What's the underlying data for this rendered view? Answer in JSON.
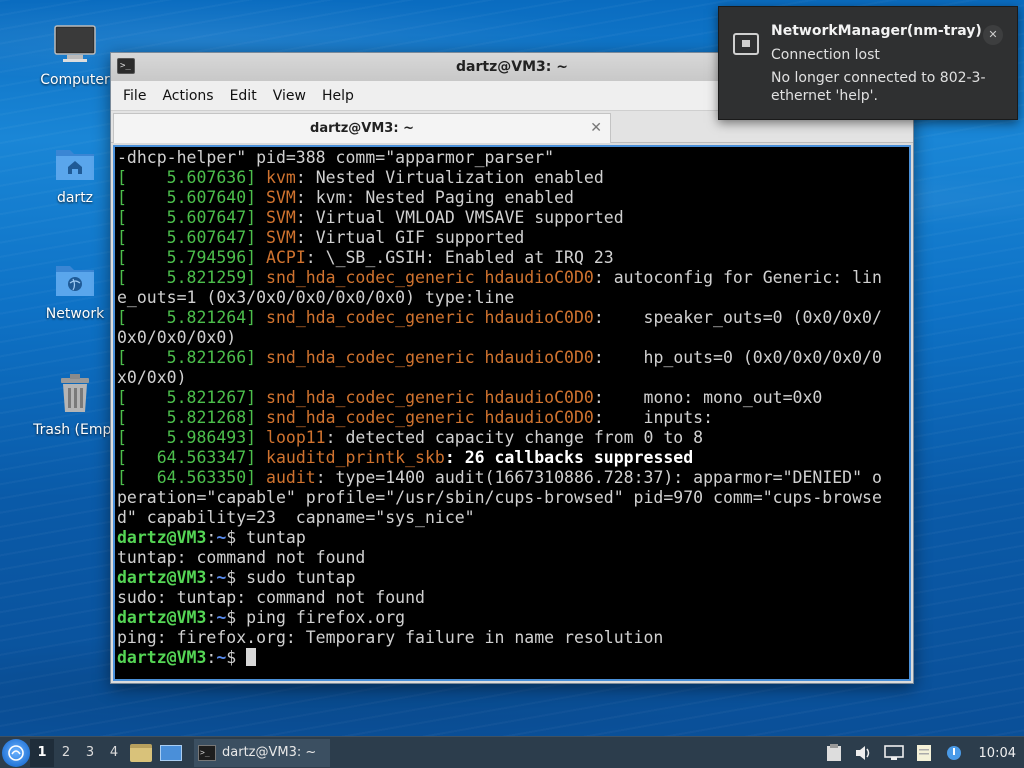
{
  "desktop": {
    "icons": [
      {
        "label": "Computer"
      },
      {
        "label": "dartz"
      },
      {
        "label": "Network"
      },
      {
        "label": "Trash (Empt"
      }
    ]
  },
  "window": {
    "title": "dartz@VM3: ~",
    "menu": [
      "File",
      "Actions",
      "Edit",
      "View",
      "Help"
    ],
    "tab_label": "dartz@VM3: ~",
    "tab_close": "✕"
  },
  "terminal": {
    "lines": [
      [
        {
          "t": "-dhcp-helper\" pid=388 comm=\"apparmor_parser\""
        }
      ],
      [
        {
          "t": "[    5.607636]",
          "c": "ts"
        },
        {
          "t": " "
        },
        {
          "t": "kvm",
          "c": "sub"
        },
        {
          "t": ": Nested Virtualization enabled"
        }
      ],
      [
        {
          "t": "[    5.607640]",
          "c": "ts"
        },
        {
          "t": " "
        },
        {
          "t": "SVM",
          "c": "sub"
        },
        {
          "t": ": kvm: Nested Paging enabled"
        }
      ],
      [
        {
          "t": "[    5.607647]",
          "c": "ts"
        },
        {
          "t": " "
        },
        {
          "t": "SVM",
          "c": "sub"
        },
        {
          "t": ": Virtual VMLOAD VMSAVE supported"
        }
      ],
      [
        {
          "t": "[    5.607647]",
          "c": "ts"
        },
        {
          "t": " "
        },
        {
          "t": "SVM",
          "c": "sub"
        },
        {
          "t": ": Virtual GIF supported"
        }
      ],
      [
        {
          "t": "[    5.794596]",
          "c": "ts"
        },
        {
          "t": " "
        },
        {
          "t": "ACPI",
          "c": "sub"
        },
        {
          "t": ": \\_SB_.GSIH: Enabled at IRQ 23"
        }
      ],
      [
        {
          "t": "[    5.821259]",
          "c": "ts"
        },
        {
          "t": " "
        },
        {
          "t": "snd_hda_codec_generic hdaudioC0D0",
          "c": "sub"
        },
        {
          "t": ": autoconfig for Generic: lin"
        }
      ],
      [
        {
          "t": "e_outs=1 (0x3/0x0/0x0/0x0/0x0) type:line"
        }
      ],
      [
        {
          "t": "[    5.821264]",
          "c": "ts"
        },
        {
          "t": " "
        },
        {
          "t": "snd_hda_codec_generic hdaudioC0D0",
          "c": "sub"
        },
        {
          "t": ":    speaker_outs=0 (0x0/0x0/"
        }
      ],
      [
        {
          "t": "0x0/0x0/0x0)"
        }
      ],
      [
        {
          "t": "[    5.821266]",
          "c": "ts"
        },
        {
          "t": " "
        },
        {
          "t": "snd_hda_codec_generic hdaudioC0D0",
          "c": "sub"
        },
        {
          "t": ":    hp_outs=0 (0x0/0x0/0x0/0"
        }
      ],
      [
        {
          "t": "x0/0x0)"
        }
      ],
      [
        {
          "t": "[    5.821267]",
          "c": "ts"
        },
        {
          "t": " "
        },
        {
          "t": "snd_hda_codec_generic hdaudioC0D0",
          "c": "sub"
        },
        {
          "t": ":    mono: mono_out=0x0"
        }
      ],
      [
        {
          "t": "[    5.821268]",
          "c": "ts"
        },
        {
          "t": " "
        },
        {
          "t": "snd_hda_codec_generic hdaudioC0D0",
          "c": "sub"
        },
        {
          "t": ":    inputs:"
        }
      ],
      [
        {
          "t": "[    5.986493]",
          "c": "ts"
        },
        {
          "t": " "
        },
        {
          "t": "loop11",
          "c": "sub"
        },
        {
          "t": ": detected capacity change from 0 to 8"
        }
      ],
      [
        {
          "t": "[   64.563347]",
          "c": "ts"
        },
        {
          "t": " "
        },
        {
          "t": "kauditd_printk_skb",
          "c": "sub"
        },
        {
          "t": ": 26 callbacks suppressed",
          "c": "boldw"
        }
      ],
      [
        {
          "t": "[   64.563350]",
          "c": "ts"
        },
        {
          "t": " "
        },
        {
          "t": "audit",
          "c": "sub"
        },
        {
          "t": ": type=1400 audit(1667310886.728:37): apparmor=\"DENIED\" o"
        }
      ],
      [
        {
          "t": "peration=\"capable\" profile=\"/usr/sbin/cups-browsed\" pid=970 comm=\"cups-browse"
        }
      ],
      [
        {
          "t": "d\" capability=23  capname=\"sys_nice\""
        }
      ],
      [
        {
          "t": "dartz@VM3",
          "c": "prompt-user"
        },
        {
          "t": ":"
        },
        {
          "t": "~",
          "c": "prompt-path"
        },
        {
          "t": "$ tuntap"
        }
      ],
      [
        {
          "t": "tuntap: command not found"
        }
      ],
      [
        {
          "t": "dartz@VM3",
          "c": "prompt-user"
        },
        {
          "t": ":"
        },
        {
          "t": "~",
          "c": "prompt-path"
        },
        {
          "t": "$ sudo tuntap"
        }
      ],
      [
        {
          "t": "sudo: tuntap: command not found"
        }
      ],
      [
        {
          "t": "dartz@VM3",
          "c": "prompt-user"
        },
        {
          "t": ":"
        },
        {
          "t": "~",
          "c": "prompt-path"
        },
        {
          "t": "$ ping firefox.org"
        }
      ],
      [
        {
          "t": "ping: firefox.org: Temporary failure in name resolution"
        }
      ],
      [
        {
          "t": "dartz@VM3",
          "c": "prompt-user"
        },
        {
          "t": ":"
        },
        {
          "t": "~",
          "c": "prompt-path"
        },
        {
          "t": "$ "
        },
        {
          "t": "",
          "c": "cursor"
        }
      ]
    ]
  },
  "notification": {
    "title": "NetworkManager(nm-tray)",
    "summary": "Connection lost",
    "body": "No longer connected to 802-3-ethernet 'help'.",
    "close": "✕",
    "icon": "network-wired-icon"
  },
  "taskbar": {
    "workspaces": [
      "1",
      "2",
      "3",
      "4"
    ],
    "active_workspace": "1",
    "task_label": "dartz@VM3: ~",
    "clock": "10:04"
  },
  "colors": {
    "timestamp": "#4cbf4c",
    "subsystem": "#d0732f",
    "prompt_user": "#55d655",
    "prompt_path": "#5a8df0",
    "terminal_bg": "#000000",
    "taskbar_bg": "#2c3d4c"
  }
}
